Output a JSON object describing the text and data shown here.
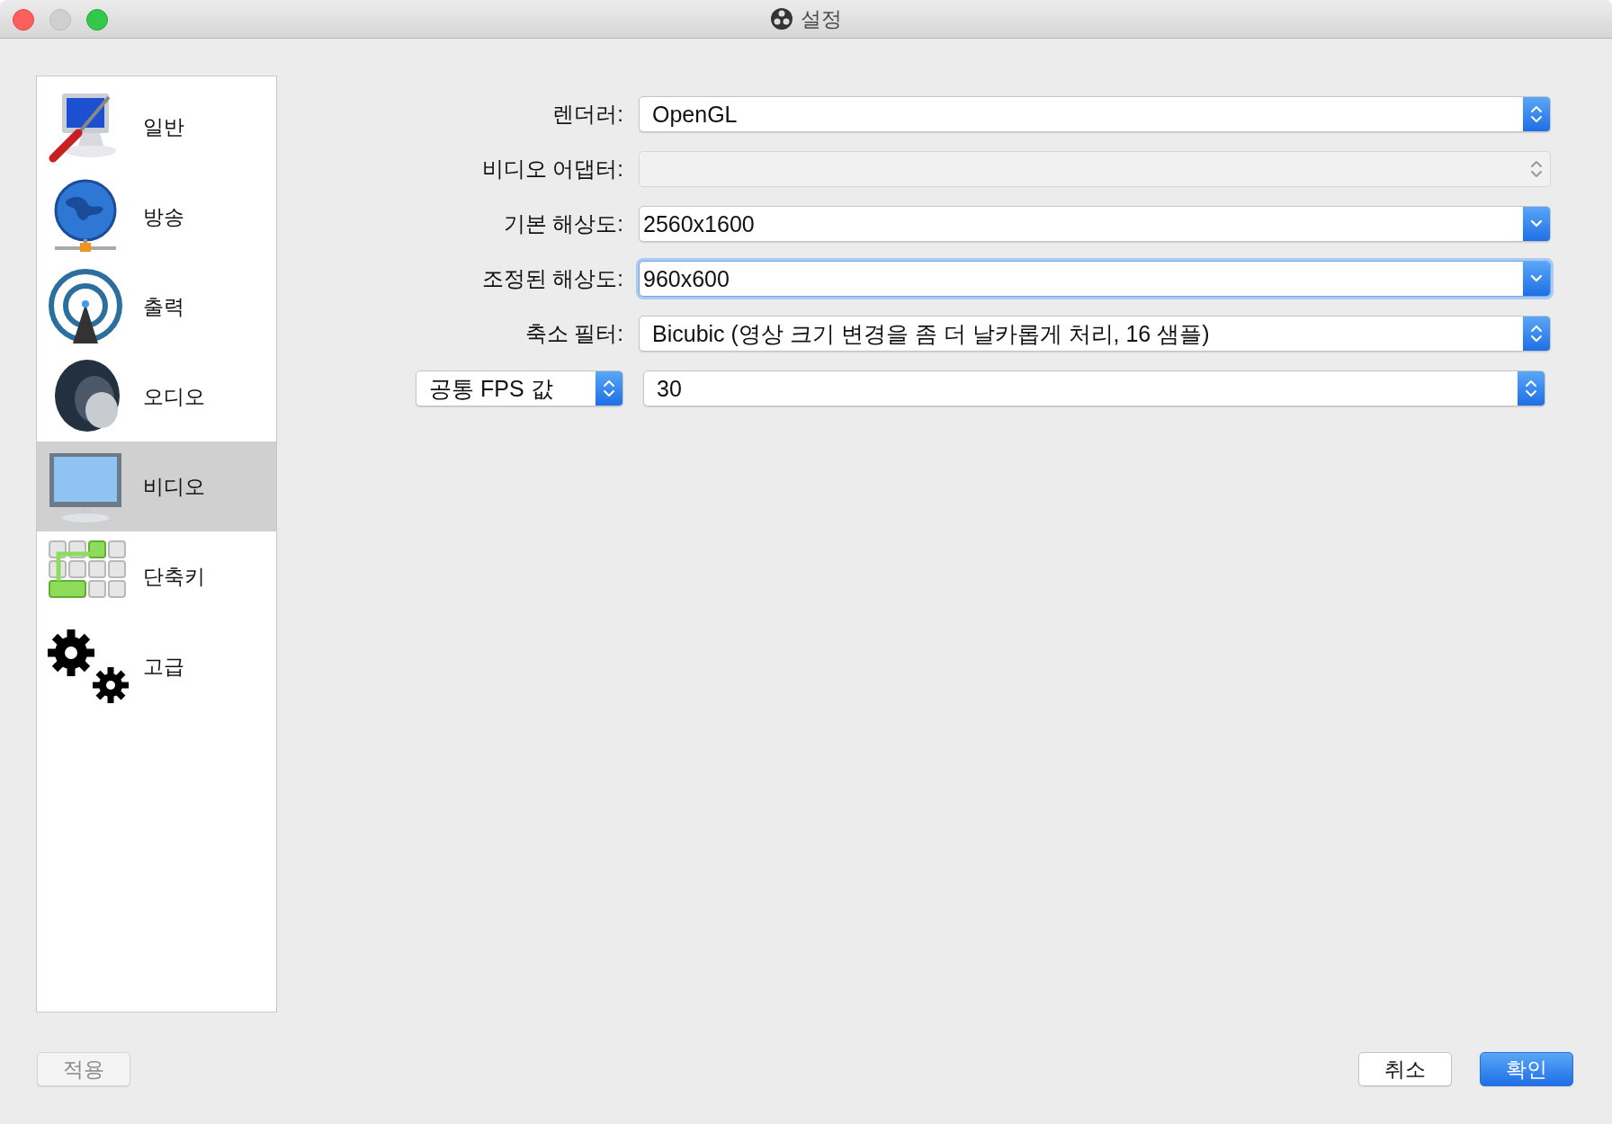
{
  "window": {
    "title": "설정"
  },
  "sidebar": {
    "items": [
      {
        "label": "일반",
        "selected": false
      },
      {
        "label": "방송",
        "selected": false
      },
      {
        "label": "출력",
        "selected": false
      },
      {
        "label": "오디오",
        "selected": false
      },
      {
        "label": "비디오",
        "selected": true
      },
      {
        "label": "단축키",
        "selected": false
      },
      {
        "label": "고급",
        "selected": false
      }
    ]
  },
  "fields": [
    {
      "label": "렌더러:",
      "kind": "popup",
      "value": "OpenGL",
      "disabled": false,
      "focused": false
    },
    {
      "label": "비디오 어댑터:",
      "kind": "popup",
      "disabled": true,
      "focused": false
    },
    {
      "label": "기본 해상도:",
      "kind": "combo",
      "value": "2560x1600",
      "disabled": false,
      "focused": false
    },
    {
      "label": "조정된 해상도:",
      "kind": "combo",
      "value": "960x600",
      "disabled": false,
      "focused": true
    },
    {
      "label": "축소 필터:",
      "kind": "popup",
      "value": "Bicubic (영상 크기 변경을 좀 더 날카롭게 처리, 16 샘플)",
      "disabled": false,
      "focused": false
    }
  ],
  "fps": {
    "mode": {
      "kind": "popup",
      "value": "공통 FPS 값",
      "disabled": false,
      "focused": false
    },
    "value": {
      "kind": "popup",
      "value": "30",
      "disabled": false,
      "focused": false
    }
  },
  "buttons": [
    {
      "label": "적용",
      "kind": "normal",
      "disabled": true
    },
    {
      "label": "취소",
      "kind": "normal",
      "disabled": false
    },
    {
      "label": "확인",
      "kind": "default",
      "disabled": false
    }
  ]
}
